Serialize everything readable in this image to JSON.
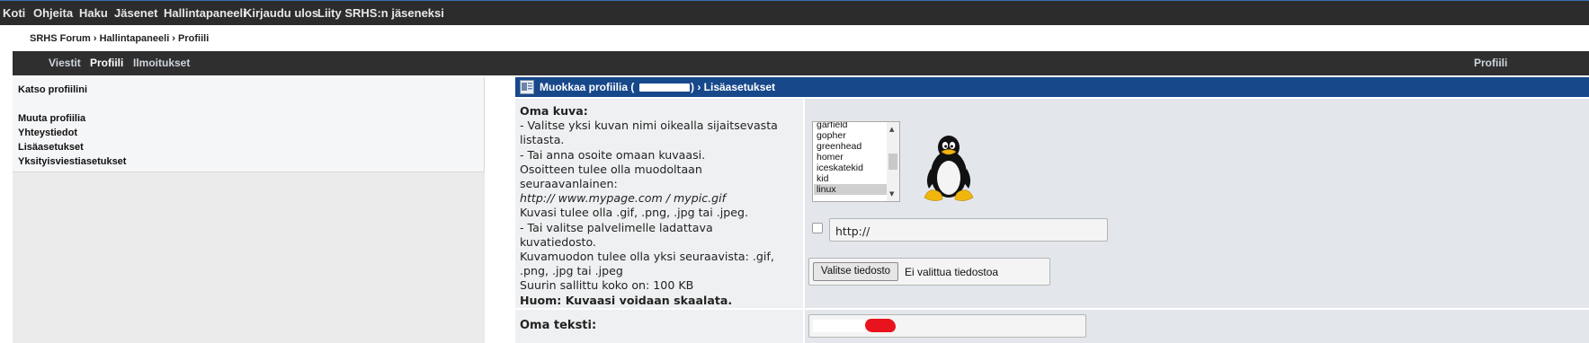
{
  "top_nav": [
    "Koti",
    "Ohjeita",
    "Haku",
    "Jäsenet",
    "Hallintapaneeli",
    "Kirjaudu ulos",
    "Liity SRHS:n jäseneksi"
  ],
  "breadcrumb": "SRHS Forum › Hallintapaneeli › Profiili",
  "sub_nav": {
    "tabs": [
      "Viestit",
      "Profiili",
      "Ilmoitukset"
    ],
    "active": "Profiili",
    "right_label": "Profiili"
  },
  "sidebar": {
    "view_profile": "Katso profiilini",
    "edit_heading": "Muuta profiilia",
    "links": [
      "Yhteystiedot",
      "Lisäasetukset",
      "Yksityisviestiasetukset"
    ]
  },
  "panel": {
    "title_prefix": "Muokkaa profiilia (",
    "title_suffix": ") › Lisäasetukset"
  },
  "avatar_section": {
    "label": "Oma kuva:",
    "lines": [
      "- Valitse yksi kuvan nimi oikealla sijaitsevasta",
      "listasta.",
      "- Tai anna osoite omaan kuvaasi.",
      "Osoitteen tulee olla muodoltaan",
      "seuraavanlainen:",
      "http:// www.mypage.com / mypic.gif",
      "Kuvasi tulee olla .gif, .png, .jpg tai .jpeg.",
      "- Tai valitse palvelimelle ladattava",
      "kuvatiedosto.",
      "Kuvamuodon tulee olla yksi seuraavista: .gif,",
      ".png, .jpg tai .jpeg",
      "Suurin sallittu koko on: 100 KB"
    ],
    "note": "Huom: Kuvaasi voidaan skaalata.",
    "avatar_options": [
      "garfield",
      "gopher",
      "greenhead",
      "homer",
      "iceskatekid",
      "kid",
      "linux"
    ],
    "selected_avatar": "linux",
    "avatar_icon": "tux-penguin-icon",
    "url_value": "http://",
    "file_button_label": "Valitse tiedosto",
    "file_status": "Ei valittua tiedostoa"
  },
  "signature_section": {
    "label": "Oma teksti:"
  },
  "colors": {
    "top_nav_bg": "#2c2c2c",
    "panel_header_bg": "#17488a",
    "redaction_mark": "#e8131c"
  }
}
